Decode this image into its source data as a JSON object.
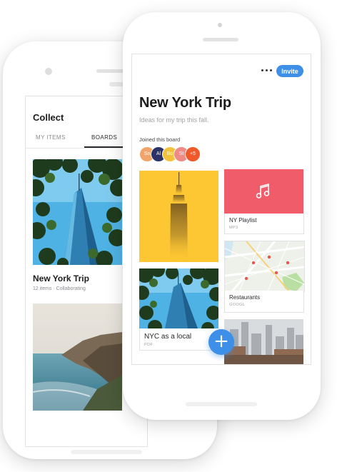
{
  "back_screen": {
    "title": "Collect",
    "tabs": [
      {
        "label": "MY ITEMS"
      },
      {
        "label": "BOARDS"
      }
    ],
    "boards": [
      {
        "name": "New York Trip",
        "meta": "12 items · Collaborating"
      }
    ]
  },
  "front_screen": {
    "more_icon": "more-horizontal-icon",
    "invite_label": "Invite",
    "title": "New York Trip",
    "description": "Ideas for my trip this fall.",
    "joined_label": "Joined this board",
    "avatars": [
      {
        "label": "Sa",
        "color": "#f0a46a"
      },
      {
        "label": "Al",
        "color": "#2b3268"
      },
      {
        "label": "Bo",
        "color": "#f2c23a"
      },
      {
        "label": "St",
        "color": "#ef8a86"
      },
      {
        "label": "+5",
        "color": "#f0592a"
      }
    ],
    "items": [
      {
        "title": "NY Playlist",
        "type": "MP3",
        "icon": "music-note-icon"
      },
      {
        "title": "Restaurants",
        "type": "GOOGL"
      },
      {
        "title": "NYC as a local",
        "type": "PDF"
      }
    ],
    "fab_icon": "plus-icon",
    "fab_label": "+"
  },
  "colors": {
    "accent": "#3d8fe8",
    "playlist_tile": "#f15c6b",
    "yellow_tile": "#fdc733"
  }
}
